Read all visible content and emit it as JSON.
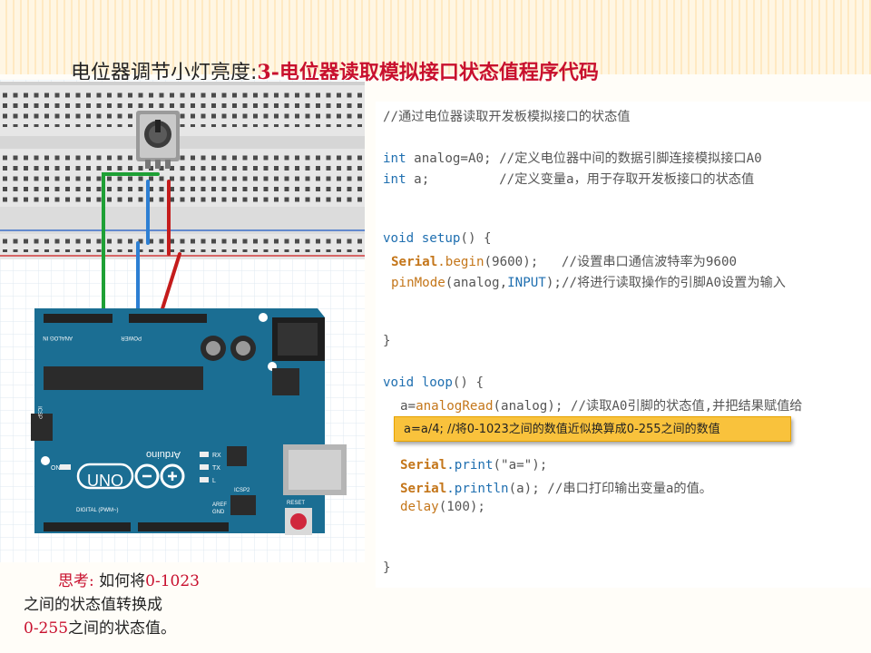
{
  "title": {
    "main": "电位器调节小灯亮度:",
    "highlight": "3-电位器读取模拟接口状态值程序代码"
  },
  "code": {
    "l1": "//通过电位器读取开发板模拟接口的状态值",
    "l2_kw": "int",
    "l2_rest": " analog=A0; //定义电位器中间的数据引脚连接模拟接口A0",
    "l3_kw": "int",
    "l3_rest": " a;         //定义变量a，用于存取开发板接口的状态值",
    "l4_kw": "void",
    "l4_fn": " setup",
    "l4_rest": "() {",
    "l5_obj": "Serial",
    "l5_fn": ".begin",
    "l5_rest": "(9600);   //设置串口通信波特率为9600",
    "l6_fn": "pinMode",
    "l6_a": "(analog,",
    "l6_kw": "INPUT",
    "l6_rest": ");//将进行读取操作的引脚A0设置为输入",
    "l7": "}",
    "l8_kw": "void",
    "l8_fn": " loop",
    "l8_rest": "() {",
    "l9_a": "a=",
    "l9_fn": "analogRead",
    "l9_rest": "(analog); //读取A0引脚的状态值,并把结果赋值给",
    "l10_obj": "Serial",
    "l10_fn": ".print",
    "l10_rest": "(\"a=\");",
    "l11_obj": "Serial",
    "l11_fn": ".println",
    "l11_rest": "(a); //串口打印输出变量a的值。",
    "l12_fn": "delay",
    "l12_rest": "(100);",
    "l13": "}"
  },
  "note": "a=a/4; //将0-1023之间的数值近似换算成0-255之间的数值",
  "think": {
    "label": "思考:",
    "l1_a": "如何将",
    "l1_b": "0-1023",
    "l2": "之间的状态值转换成",
    "l3_a": "0-255",
    "l3_b": "之间的状态值。"
  },
  "board": {
    "uno": "UNO",
    "brand": "Arduino",
    "analog_in": "ANALOG IN",
    "power": "POWER",
    "digital": "DIGITAL (PWM~)",
    "icsp": "ICSP",
    "icsp2": "ICSP2",
    "reset": "RESET",
    "on": "ON",
    "l": "L",
    "tx": "TX",
    "rx": "RX",
    "aref": "AREF",
    "gnd": "GND"
  },
  "colors": {
    "title_red": "#c8102e",
    "board_blue": "#1b6e93",
    "note_bg": "#f9c23c"
  }
}
